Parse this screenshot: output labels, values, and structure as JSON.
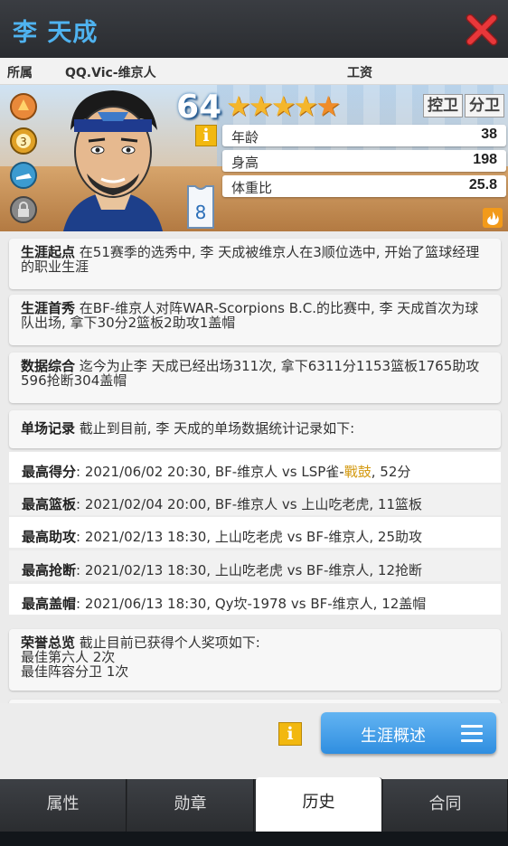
{
  "header": {
    "title": "李 天成",
    "close_icon": "close-icon"
  },
  "strip": {
    "team_label": "所属",
    "team_value": "QQ.Vic-维京人",
    "salary_label": "工资"
  },
  "hero": {
    "overall": "64",
    "stars": 4.5,
    "positions": [
      "控卫",
      "分卫"
    ],
    "jersey_number": "8",
    "attributes": [
      {
        "label": "年龄",
        "value": "38"
      },
      {
        "label": "身高",
        "value": "198"
      },
      {
        "label": "体重比",
        "value": "25.8"
      }
    ]
  },
  "cards": {
    "start": {
      "title": "生涯起点",
      "text": "在51赛季的选秀中, 李 天成被维京人在3顺位选中, 开始了篮球经理的职业生涯"
    },
    "debut": {
      "title": "生涯首秀",
      "text": "在BF-维京人对阵WAR-Scorpions B.C.的比赛中, 李 天成首次为球队出场, 拿下30分2篮板2助攻1盖帽"
    },
    "summary": {
      "title": "数据综合",
      "text": "迄今为止李 天成已经出场311次, 拿下6311分1153篮板1765助攻596抢断304盖帽"
    },
    "records": {
      "title": "单场记录",
      "text": "截止到目前, 李 天成的单场数据统计记录如下:"
    },
    "honors": {
      "title": "荣誉总览",
      "text": "截止目前已获得个人奖项如下:",
      "items": [
        "最佳第六人  2次",
        "最佳阵容分卫  1次"
      ]
    }
  },
  "records": [
    {
      "label": "最高得分",
      "pre": ": 2021/06/02 20:30, BF-维京人 vs LSP雀-",
      "hl": "戰鼓",
      "post": ", 52分"
    },
    {
      "label": "最高篮板",
      "pre": ": 2021/02/04 20:00, BF-维京人 vs 上山吃老虎, 11篮板",
      "hl": "",
      "post": ""
    },
    {
      "label": "最高助攻",
      "pre": ": 2021/02/13 18:30, 上山吃老虎 vs BF-维京人, 25助攻",
      "hl": "",
      "post": ""
    },
    {
      "label": "最高抢断",
      "pre": ": 2021/02/13 18:30, 上山吃老虎 vs BF-维京人, 12抢断",
      "hl": "",
      "post": ""
    },
    {
      "label": "最高盖帽",
      "pre": ": 2021/06/13 18:30, Qy坎-1978 vs BF-维京人, 12盖帽",
      "hl": "",
      "post": ""
    }
  ],
  "actions": {
    "career_button": "生涯概述"
  },
  "tabs": [
    "属性",
    "勋章",
    "历史",
    "合同"
  ],
  "active_tab": "历史",
  "colors": {
    "accent": "#4fb3f0",
    "close": "#e03030",
    "highlight": "#d49a12",
    "button": "#3d99e6"
  }
}
